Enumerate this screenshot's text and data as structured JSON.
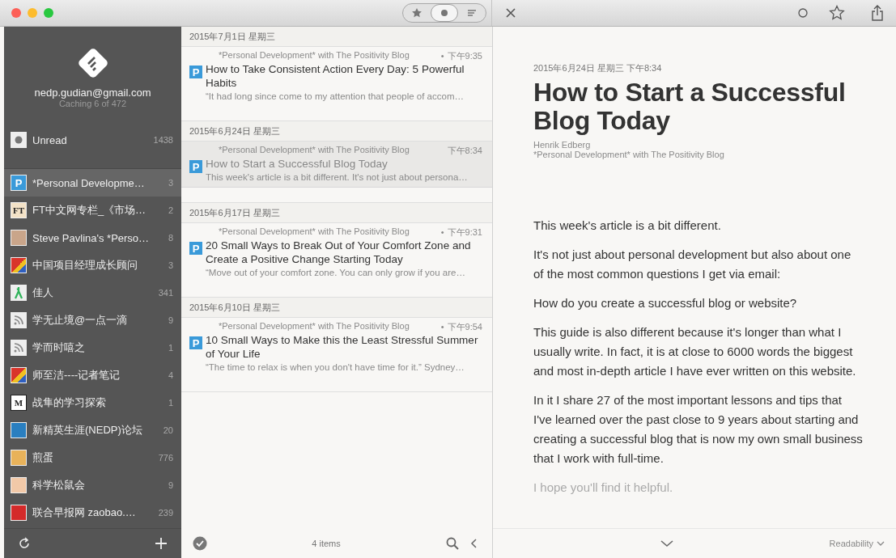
{
  "toolbar": {
    "view_modes": [
      {
        "kind": "star",
        "selected": false
      },
      {
        "kind": "dot",
        "selected": true
      },
      {
        "kind": "list",
        "selected": false
      }
    ]
  },
  "sidebar": {
    "account": "nedp.gudian@gmail.com",
    "caching": "Caching 6 of 472",
    "unread": {
      "label": "Unread",
      "count": "1438"
    },
    "feeds": [
      {
        "label": "*Personal Developme…",
        "count": "3",
        "kind": "letter",
        "badge": "P",
        "color": "#3a9ad9",
        "selected": true
      },
      {
        "label": "FT中文网专栏_《市场…",
        "count": "2",
        "kind": "letter",
        "badge": "FT",
        "color": "#f3e2c7",
        "selected": false
      },
      {
        "label": "Steve Pavlina's *Perso…",
        "count": "8",
        "kind": "photo",
        "color": "#c9a58a",
        "selected": false
      },
      {
        "label": "中国项目经理成长顾问",
        "count": "3",
        "kind": "mosaic",
        "color": "#d9342b",
        "selected": false
      },
      {
        "label": "佳人",
        "count": "341",
        "kind": "figure",
        "color": "#2fb35a",
        "selected": false
      },
      {
        "label": "学无止境@一点一滴",
        "count": "9",
        "kind": "rss",
        "color": "#eeeeee",
        "selected": false
      },
      {
        "label": "学而时嘻之",
        "count": "1",
        "kind": "rss",
        "color": "#eeeeee",
        "selected": false
      },
      {
        "label": "师至洁----记者笔记",
        "count": "4",
        "kind": "mosaic",
        "color": "#d9342b",
        "selected": false
      },
      {
        "label": "战隼的学习探索",
        "count": "1",
        "kind": "letter",
        "badge": "M",
        "color": "#ffffff",
        "selected": false
      },
      {
        "label": "新精英生涯(NEDP)论坛",
        "count": "20",
        "kind": "photo",
        "color": "#2a7fc0",
        "selected": false
      },
      {
        "label": "煎蛋",
        "count": "776",
        "kind": "photo",
        "color": "#e8b25a",
        "selected": false
      },
      {
        "label": "科学松鼠会",
        "count": "9",
        "kind": "photo",
        "color": "#f2c9a8",
        "selected": false
      },
      {
        "label": "联合早报网 zaobao.…",
        "count": "239",
        "kind": "photo",
        "color": "#d42a2a",
        "selected": false
      }
    ]
  },
  "article_list": {
    "groups": [
      {
        "date": "2015年7月1日 星期三",
        "items": [
          {
            "source": "*Personal Development* with The Positivity Blog",
            "marker": "•",
            "time": "下午9:35",
            "unread": true,
            "selected": false,
            "badge": "P",
            "title": "How to Take Consistent Action Every Day: 5 Powerful Habits",
            "snippet": "“It had long since come to my attention that people of accom…"
          }
        ]
      },
      {
        "date": "2015年6月24日 星期三",
        "items": [
          {
            "source": "*Personal Development* with The Positivity Blog",
            "time": "下午8:34",
            "unread": false,
            "selected": true,
            "badge": "P",
            "title": "How to Start a Successful Blog Today",
            "snippet": "This week's article is a bit different. It's not just about persona…"
          }
        ]
      },
      {
        "date": "2015年6月17日 星期三",
        "items": [
          {
            "source": "*Personal Development* with The Positivity Blog",
            "marker": "•",
            "time": "下午9:31",
            "unread": true,
            "selected": false,
            "badge": "P",
            "title": "20 Small Ways to Break Out of Your Comfort Zone and Create a Positive Change Starting Today",
            "snippet": "“Move out of your comfort zone. You can only grow if you are…"
          }
        ]
      },
      {
        "date": "2015年6月10日 星期三",
        "items": [
          {
            "source": "*Personal Development* with The Positivity Blog",
            "marker": "•",
            "time": "下午9:54",
            "unread": true,
            "selected": false,
            "badge": "P",
            "title": "10 Small Ways to Make this the Least Stressful Summer of Your Life",
            "snippet": "“The time to relax is when you don't have time for it.” Sydney…"
          }
        ]
      }
    ],
    "count": "4 items"
  },
  "reader": {
    "date": "2015年6月24日 星期三 下午8:34",
    "title": "How to Start a Successful Blog Today",
    "author": "Henrik Edberg",
    "source": "*Personal Development* with The Positivity Blog",
    "paragraphs": [
      "This week's article is a bit different.",
      "It's not just about personal development but also about one of the most common questions I get via email:",
      "How do you create a successful blog or website?",
      "This guide is also different because it's longer than what I usually write. In fact, it is at close to 6000 words the biggest and most in-depth article I have ever written on this website.",
      "In it I share 27 of the most important lessons and tips that I've learned over the past close to 9 years about starting and creating a successful blog that is now my own small business that I work with full-time.",
      "I hope you'll find it helpful."
    ],
    "view_menu": "Readability"
  }
}
